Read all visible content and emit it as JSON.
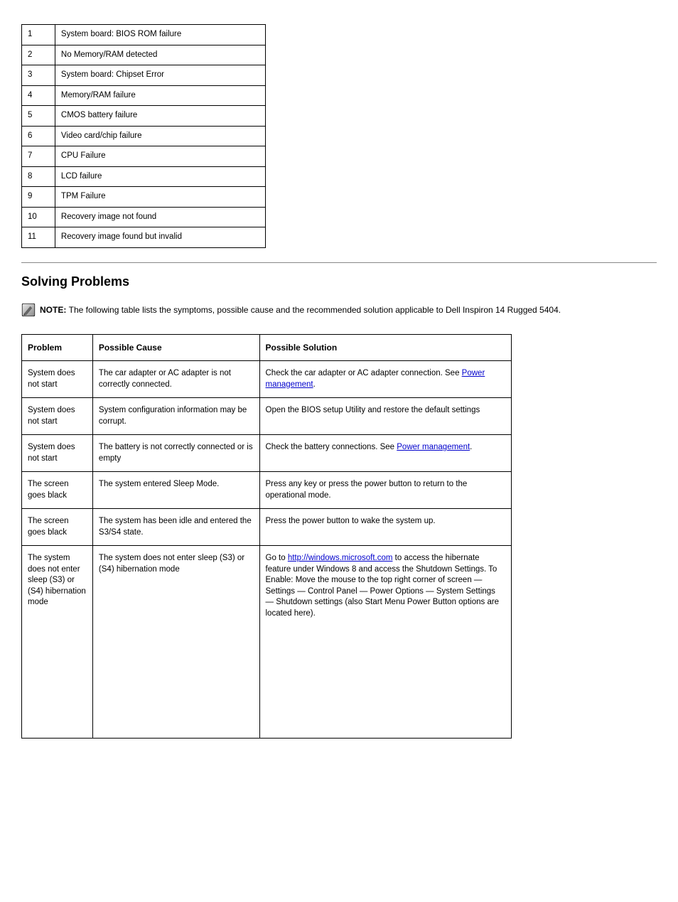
{
  "led_codes": [
    {
      "num": "1",
      "desc": "System board: BIOS ROM failure"
    },
    {
      "num": "2",
      "desc": "No Memory/RAM detected"
    },
    {
      "num": "3",
      "desc": "System board: Chipset Error"
    },
    {
      "num": "4",
      "desc": "Memory/RAM failure"
    },
    {
      "num": "5",
      "desc": "CMOS battery failure"
    },
    {
      "num": "6",
      "desc": "Video card/chip failure"
    },
    {
      "num": "7",
      "desc": "CPU Failure"
    },
    {
      "num": "8",
      "desc": "LCD failure"
    },
    {
      "num": "9",
      "desc": "TPM Failure"
    },
    {
      "num": "10",
      "desc": "Recovery image not found"
    },
    {
      "num": "11",
      "desc": "Recovery image found but invalid"
    }
  ],
  "section_title": "Solving Problems",
  "note_prefix": "NOTE: ",
  "note_body": "The following table lists the symptoms, possible cause and the recommended solution applicable to Dell Inspiron 14 Rugged 5404.",
  "table": {
    "headers": [
      "Problem",
      "Possible Cause",
      "Possible Solution"
    ],
    "rows": [
      {
        "problem": "System does not start",
        "cause": "The car adapter or AC adapter is not correctly connected.",
        "solution_parts": [
          {
            "type": "text",
            "text": "Check the car adapter or AC adapter connection. See "
          },
          {
            "type": "link",
            "text": "Power management"
          },
          {
            "type": "text",
            "text": "."
          }
        ],
        "solution_class": ""
      },
      {
        "problem": "System does not start",
        "cause": "System configuration information may be corrupt.",
        "solution_parts": [
          {
            "type": "text",
            "text": "Open the BIOS setup Utility and restore the default settings"
          }
        ]
      },
      {
        "problem": "System does not start",
        "cause": "The battery is not correctly connected or is empty",
        "solution_parts": [
          {
            "type": "text",
            "text": "Check the battery connections. See "
          },
          {
            "type": "link",
            "text": "Power management"
          },
          {
            "type": "text",
            "text": "."
          }
        ]
      },
      {
        "problem": "The screen goes black",
        "cause": "The system entered Sleep Mode.",
        "solution_parts": [
          {
            "type": "text",
            "text": "Press any key or press the power button to return to the operational mode."
          }
        ]
      },
      {
        "problem": "The screen goes black",
        "cause": "The system has been idle and entered the S3/S4 state.",
        "solution_parts": [
          {
            "type": "text",
            "text": "Press the power button to wake the system up."
          }
        ]
      },
      {
        "problem": "The system does not enter sleep (S3) or (S4) hibernation mode",
        "cause": "The system does not enter sleep (S3) or (S4) hibernation mode",
        "solution_parts": [
          {
            "type": "text",
            "text": "Go to "
          },
          {
            "type": "link",
            "text": "http://windows.microsoft.com"
          },
          {
            "type": "text",
            "text": " to access the hibernate feature under Windows 8 and access the Shutdown Settings. To Enable: Move the mouse to the top right corner of screen — Settings — Control Panel — Power Options — System Settings — Shutdown settings (also Start Menu Power Button options are located here)."
          }
        ]
      }
    ]
  }
}
